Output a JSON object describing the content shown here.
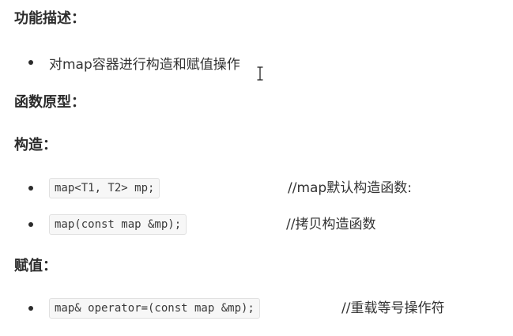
{
  "sections": {
    "function_desc": {
      "heading": "功能描述：",
      "bullet": "对map容器进行构造和赋值操作"
    },
    "prototype": {
      "heading": "函数原型："
    },
    "construct": {
      "heading": "构造：",
      "items": [
        {
          "code": "map<T1, T2> mp;",
          "comment": "//map默认构造函数:"
        },
        {
          "code": "map(const map &mp);",
          "comment": "//拷贝构造函数"
        }
      ]
    },
    "assign": {
      "heading": "赋值：",
      "items": [
        {
          "code": "map& operator=(const map &mp);",
          "comment": "//重载等号操作符"
        }
      ]
    }
  },
  "icons": {
    "text_cursor": "text-cursor-icon"
  }
}
